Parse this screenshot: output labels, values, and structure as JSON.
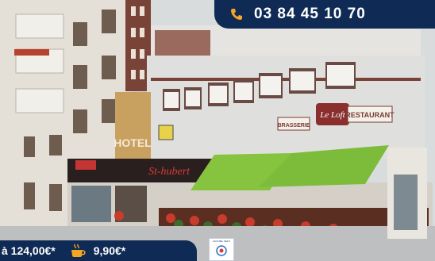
{
  "header": {
    "phone_number": "03 84 45 10 70",
    "phone_icon": "phone-icon"
  },
  "signs": {
    "hotel": "HOTEL",
    "brand": "St-hubert",
    "restaurant_name": "Le Loft",
    "brasserie": "BRASSERIE",
    "restaurant": "RESTAURANT"
  },
  "footer": {
    "room_price": "à 124,00€*",
    "breakfast_icon": "coffee-cup-icon",
    "breakfast_price": "9,90€*",
    "badge_text": "ACCUEIL VELO"
  },
  "colors": {
    "navy": "#0f2a54",
    "phone_icon": "#f5a623",
    "awning": "#86c440",
    "storefront": "#2a1f1f",
    "building": "#dfe0dd"
  }
}
